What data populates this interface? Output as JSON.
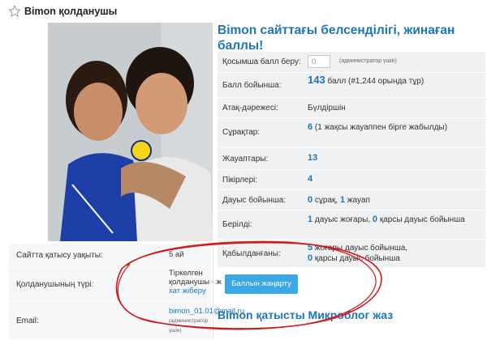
{
  "page": {
    "title": "Bimon қолданушы",
    "star_icon": "star-outline-icon"
  },
  "activity": {
    "title": "Bimon сайттағы белсенділігі, жинаған баллы!",
    "rows": {
      "bonus": {
        "label": "Қосымша балл беру:",
        "input_value": "0",
        "note": "(администратор үшін)"
      },
      "points": {
        "label": "Балл бойынша:",
        "value": "143",
        "suffix": " балл (#1,244 орында тұр)"
      },
      "rank": {
        "label": "Атақ-дәрежесі:",
        "value": "Бүлдіршін"
      },
      "questions": {
        "label": "Сұрақтар:",
        "value": "6",
        "suffix": " (1 жақсы жауаппен бірге жабылды)"
      },
      "answers": {
        "label": "Жауаптары:",
        "value": "13"
      },
      "comments": {
        "label": "Пікірлері:",
        "value": "4"
      },
      "votes_cast": {
        "label": "Дауыс бойынша:",
        "q": "0",
        "q_word": " сұрақ, ",
        "a": "1",
        "a_word": " жауап"
      },
      "votes_given": {
        "label": "Берілді:",
        "up": "1",
        "up_word": " дауыс жоғары, ",
        "down": "0",
        "down_word": " қарсы дауыс бойынша"
      },
      "votes_received": {
        "label": "Қабылданғаны:",
        "up": "5",
        "up_word": " жоғары дауыс бойынша,",
        "down": "0",
        "down_word": " қарсы дауыс бойынша"
      }
    }
  },
  "profile": {
    "member_since": {
      "label": "Сайтта қатысу уақыты:",
      "value": "5 ай"
    },
    "user_type": {
      "label": "Қолданушының түрі:",
      "value_line1": "Тіркелген",
      "value_line2": "қолданушы - ж",
      "link": "хат жіберу"
    },
    "email": {
      "label": "Email:",
      "value": "bimon_01.01@mail.ru",
      "note": "(администратор үшін)"
    }
  },
  "actions": {
    "update_points": "Баллын жаңарту"
  },
  "microblog": {
    "title": "Bimon қатысты Микроблог жаз"
  },
  "colors": {
    "accent": "#1f75b8",
    "button": "#3aa7e6",
    "annotation": "#d01818"
  }
}
